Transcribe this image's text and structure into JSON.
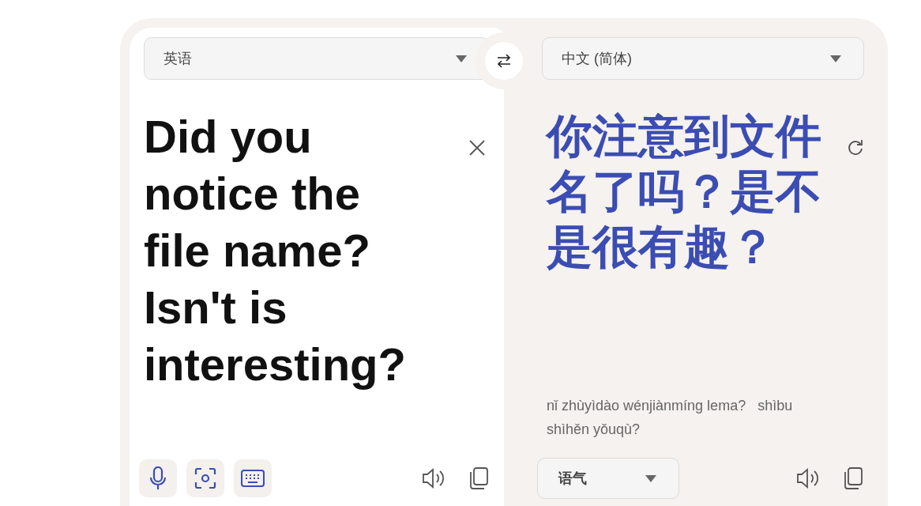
{
  "source": {
    "language": "英语",
    "text": "Did you notice the file name? Isn't is interesting?"
  },
  "target": {
    "language": "中文 (简体)",
    "text": "你注意到文件名了吗？是不是很有趣？",
    "pinyin": "nǐ zhùyìdào wénjiànmíng lema?   shìbu shìhěn yǒuqù?",
    "tone": "语气"
  }
}
